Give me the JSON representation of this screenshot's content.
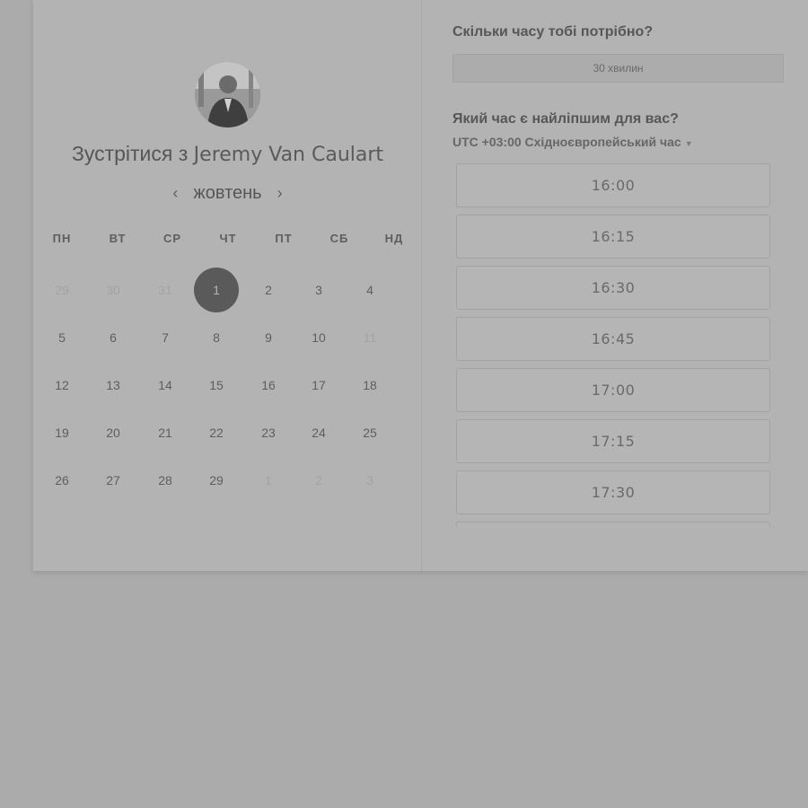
{
  "meeting": {
    "prefix": "Зустрітися з",
    "host": "Jeremy Van Caulart"
  },
  "calendar": {
    "month": "жовтень",
    "prev_icon": "chevron-left-icon",
    "next_icon": "chevron-right-icon",
    "weekdays": [
      "ПН",
      "ВТ",
      "СР",
      "ЧТ",
      "ПТ",
      "СБ",
      "НД"
    ],
    "weeks": [
      [
        {
          "d": "29",
          "m": true
        },
        {
          "d": "30",
          "m": true
        },
        {
          "d": "31",
          "m": true
        },
        {
          "d": "1",
          "sel": true
        },
        {
          "d": "2"
        },
        {
          "d": "3"
        },
        {
          "d": "4"
        }
      ],
      [
        {
          "d": "5"
        },
        {
          "d": "6"
        },
        {
          "d": "7"
        },
        {
          "d": "8"
        },
        {
          "d": "9"
        },
        {
          "d": "10"
        },
        {
          "d": "11",
          "m": true
        }
      ],
      [
        {
          "d": "12"
        },
        {
          "d": "13"
        },
        {
          "d": "14"
        },
        {
          "d": "15"
        },
        {
          "d": "16"
        },
        {
          "d": "17"
        },
        {
          "d": "18"
        }
      ],
      [
        {
          "d": "19"
        },
        {
          "d": "20"
        },
        {
          "d": "21"
        },
        {
          "d": "22"
        },
        {
          "d": "23"
        },
        {
          "d": "24"
        },
        {
          "d": "25"
        }
      ],
      [
        {
          "d": "26"
        },
        {
          "d": "27"
        },
        {
          "d": "28"
        },
        {
          "d": "29"
        },
        {
          "d": "1",
          "m": true
        },
        {
          "d": "2",
          "m": true
        },
        {
          "d": "3",
          "m": true
        }
      ]
    ]
  },
  "duration": {
    "question": "Скільки часу тобі потрібно?",
    "selected": "30 хвилин"
  },
  "time": {
    "question": "Який час є найліпшим для вас?",
    "timezone": "UTC +03:00 Східноєвропейський час",
    "slots": [
      "16:00",
      "16:15",
      "16:30",
      "16:45",
      "17:00",
      "17:15",
      "17:30",
      ""
    ]
  },
  "colors": {
    "background": "#ababab",
    "card": "#b3b3b3",
    "selected_day": "#5a5a5a"
  }
}
